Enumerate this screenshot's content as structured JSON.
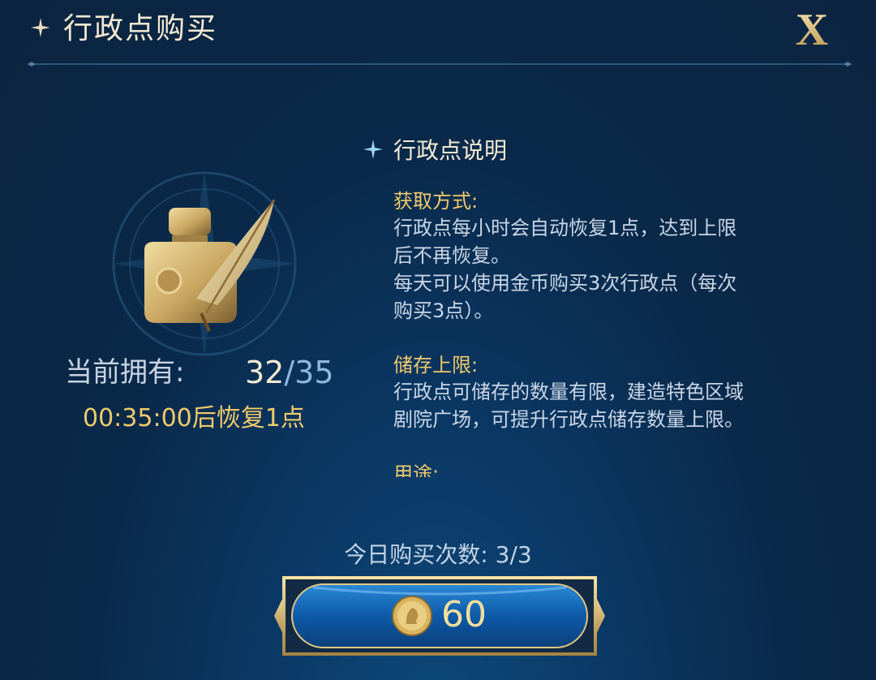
{
  "header": {
    "title": "行政点购买",
    "close_label": "X"
  },
  "status": {
    "own_label": "当前拥有:",
    "current": "32",
    "separator": "/",
    "max": "35",
    "recover_text": "00:35:00后恢复1点"
  },
  "description": {
    "title": "行政点说明",
    "sections": [
      {
        "heading": "获取方式:",
        "lines": [
          "行政点每小时会自动恢复1点，达到上限",
          "后不再恢复。",
          "每天可以使用金币购买3次行政点（每次",
          "购买3点）。"
        ]
      },
      {
        "heading": "储存上限:",
        "lines": [
          "行政点可储存的数量有限，建造特色区域",
          "剧院广场，可提升行政点储存数量上限。"
        ]
      },
      {
        "heading": "用途:",
        "lines": []
      }
    ]
  },
  "purchase": {
    "count_text": "今日购买次数: 3/3",
    "price": "60"
  },
  "colors": {
    "gold": "#f0ca6b",
    "bg": "#0a2848",
    "button_blue": "#0e5aa8"
  }
}
